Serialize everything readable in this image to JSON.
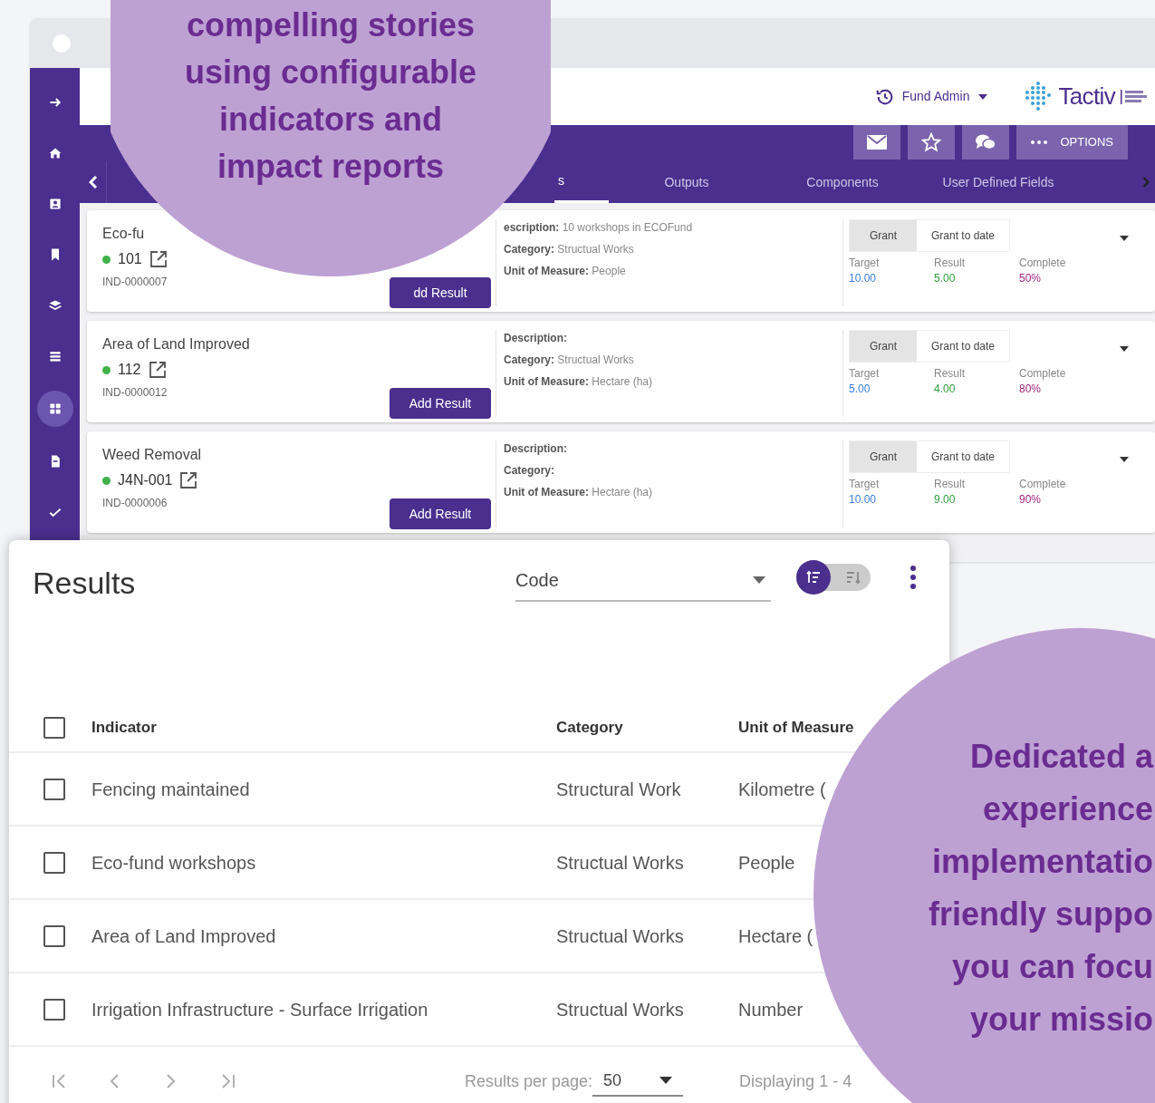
{
  "back_window": {
    "header": {
      "user_menu": "Fund Admin",
      "logo": "Tactiv"
    },
    "sidebar": [
      {
        "selected": false
      },
      {
        "selected": false
      },
      {
        "selected": false
      },
      {
        "selected": false
      },
      {
        "selected": false
      },
      {
        "selected": false
      },
      {
        "selected": true
      },
      {
        "selected": false
      },
      {
        "selected": false
      }
    ],
    "toolbar": {
      "options_label": "OPTIONS"
    },
    "tabs": [
      {
        "label": "s",
        "selected": true
      },
      {
        "label": "Outputs",
        "selected": false
      },
      {
        "label": "Components",
        "selected": false
      },
      {
        "label": "User Defined Fields",
        "selected": false
      }
    ],
    "cards": [
      {
        "name": "Eco-fu",
        "code": "101",
        "id": "IND-0000007",
        "button": "dd Result",
        "description_label": "escription:",
        "description": "10 workshops in ECOFund",
        "category_label": "Category:",
        "category": "Structual Works",
        "unit_label": "Unit of Measure:",
        "unit": "People",
        "toggles": [
          {
            "label": "Grant",
            "selected": true
          },
          {
            "label": "Grant to date",
            "selected": false
          }
        ],
        "metrics": [
          {
            "kind": "target",
            "label": "Target",
            "value": "10.00"
          },
          {
            "kind": "result",
            "label": "Result",
            "value": "5.00"
          },
          {
            "kind": "complete",
            "label": "Complete",
            "value": "50%"
          }
        ]
      },
      {
        "name": "Area of Land Improved",
        "code": "112",
        "id": "IND-0000012",
        "button": "Add Result",
        "description_label": "Description:",
        "category_label": "Category:",
        "category": "Structual Works",
        "unit_label": "Unit of Measure:",
        "unit": "Hectare (ha)",
        "toggles": [
          {
            "label": "Grant",
            "selected": true
          },
          {
            "label": "Grant to date",
            "selected": false
          }
        ],
        "metrics": [
          {
            "kind": "target",
            "label": "Target",
            "value": "5.00"
          },
          {
            "kind": "result",
            "label": "Result",
            "value": "4.00"
          },
          {
            "kind": "complete",
            "label": "Complete",
            "value": "80%"
          }
        ]
      },
      {
        "name": "Weed Removal",
        "code": "J4N-001",
        "id": "IND-0000006",
        "button": "Add Result",
        "description_label": "Description:",
        "category_label": "Category:",
        "unit_label": "Unit of Measure:",
        "unit": "Hectare (ha)",
        "toggles": [
          {
            "label": "Grant",
            "selected": true
          },
          {
            "label": "Grant to date",
            "selected": false
          }
        ],
        "metrics": [
          {
            "kind": "target",
            "label": "Target",
            "value": "10.00"
          },
          {
            "kind": "result",
            "label": "Result",
            "value": "9.00"
          },
          {
            "kind": "complete",
            "label": "Complete",
            "value": "90%"
          }
        ]
      }
    ]
  },
  "results_panel": {
    "title": "Results",
    "sort_field": "Code",
    "sort_order": [
      {
        "selected": true
      },
      {
        "selected": false
      }
    ],
    "columns": [
      "Indicator",
      "Category",
      "Unit of Measure"
    ],
    "header_checked": false,
    "rows": [
      {
        "checked": false,
        "indicator": "Fencing maintained",
        "category": "Structural Work",
        "unit": "Kilometre ("
      },
      {
        "checked": false,
        "indicator": "Eco-fund workshops",
        "category": "Structual Works",
        "unit": "People"
      },
      {
        "checked": false,
        "indicator": "Area of Land Improved",
        "category": "Structual Works",
        "unit": "Hectare ("
      },
      {
        "checked": false,
        "indicator": "Irrigation Infrastructure - Surface Irrigation",
        "category": "Structual Works",
        "unit": "Number"
      }
    ],
    "footer": {
      "per_page_label": "Results per page:",
      "per_page": "50",
      "displaying": "Displaying 1 - 4"
    }
  },
  "callouts": [
    {
      "lines": [
        "compelling stories",
        "using configurable",
        "indicators and",
        "impact reports"
      ]
    },
    {
      "lines": [
        "Dedicated a",
        "experience",
        "implementatio",
        "friendly suppo",
        "you can focu",
        "your missio"
      ]
    }
  ]
}
